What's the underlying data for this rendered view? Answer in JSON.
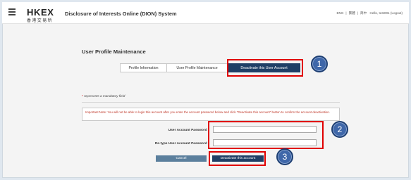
{
  "header": {
    "logo_en": "HKEX",
    "logo_zh": "香港交易所",
    "system_title": "Disclosure of Interests Online (DION) System",
    "lang_en": "ENG",
    "lang_tc": "繁體",
    "lang_sc": "简中",
    "greeting": "Hello, test001 (Logout)"
  },
  "page": {
    "section_title": "User Profile Maintenance"
  },
  "tabs": [
    {
      "label": "Profile Information"
    },
    {
      "label": "User Profile Maintenance"
    },
    {
      "label": "Deactivate this User Account"
    }
  ],
  "form": {
    "mandatory_star": "*",
    "mandatory_note": "represents a mandatory field",
    "notice": "Important Note: You will not be able to login this account after you enter the account password below and click \"Deactivate this account\" button to confirm the account deactivation.",
    "password_label": "User Account Password",
    "retype_label": "Re-type User Account Password",
    "required_star": "*",
    "password_value": "",
    "retype_value": ""
  },
  "buttons": {
    "cancel": "Cancel",
    "deactivate": "Deactivate this account"
  },
  "annotations": {
    "step1": "1",
    "step2": "2",
    "step3": "3",
    "highlight_color": "#e00000",
    "badge_color": "#3f67a9"
  }
}
